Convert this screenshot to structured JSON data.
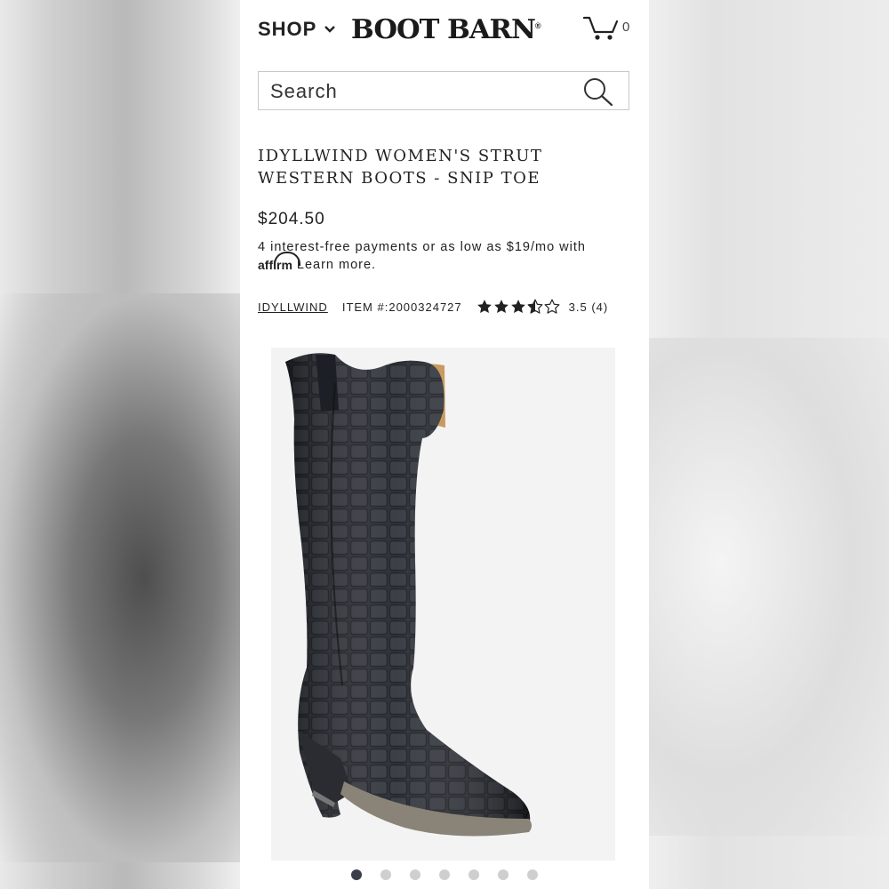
{
  "header": {
    "shop_label": "SHOP",
    "logo_text": "BOOT BARN",
    "logo_mark": "®",
    "cart_count": "0"
  },
  "search": {
    "placeholder": "Search"
  },
  "product": {
    "title_line1": "IDYLLWIND WOMEN'S STRUT",
    "title_line2": "WESTERN BOOTS - SNIP TOE",
    "price": "$204.50",
    "financing_line1": "4 interest-free payments or as low as $19/mo with",
    "affirm_logo": "affirm",
    "learn_more": "Learn more.",
    "brand": "IDYLLWIND",
    "item_number": "ITEM #:2000324727",
    "rating_value": 3.5,
    "rating_max": 5,
    "rating_text": "3.5 (4)",
    "image_alt": "Black croc-embossed tall western boot",
    "image_count": 7,
    "active_image_index": 0
  },
  "colors": {
    "text": "#222222",
    "page_background": "#ffffff",
    "dot_active": "#3a3f4a",
    "dot_inactive": "#cfcfcf"
  }
}
